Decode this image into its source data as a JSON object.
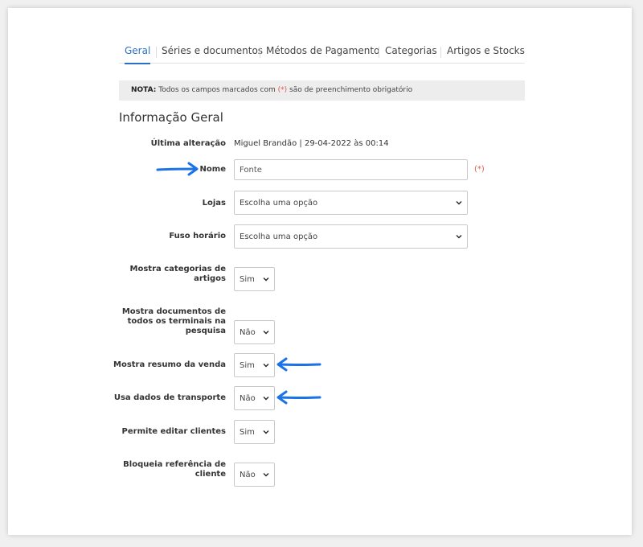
{
  "tabs": [
    {
      "label": "Geral",
      "active": true
    },
    {
      "label": "Séries e documentos",
      "active": false
    },
    {
      "label": "Métodos de Pagamento",
      "active": false
    },
    {
      "label": "Categorias",
      "active": false
    },
    {
      "label": "Artigos e Stocks",
      "active": false
    }
  ],
  "note": {
    "prefix": "NOTA:",
    "text_before": " Todos os campos marcados com ",
    "marker": "(*)",
    "text_after": " são de preenchimento obrigatório"
  },
  "section_title": "Informação Geral",
  "form": {
    "last_change_label": "Última alteração",
    "last_change_value": "Miguel Brandão | 29-04-2022 às 00:14",
    "name_label": "Nome",
    "name_value": "Fonte",
    "required_marker": "(*)",
    "stores_label": "Lojas",
    "stores_value": "Escolha uma opção",
    "timezone_label": "Fuso horário",
    "timezone_value": "Escolha uma opção",
    "show_categories_label": "Mostra categorias de artigos",
    "show_categories_value": "Sim",
    "show_all_docs_label": "Mostra documentos de todos os terminais na pesquisa",
    "show_all_docs_value": "Não",
    "show_summary_label": "Mostra resumo da venda",
    "show_summary_value": "Sim",
    "transport_label": "Usa dados de transporte",
    "transport_value": "Não",
    "edit_clients_label": "Permite editar clientes",
    "edit_clients_value": "Sim",
    "lock_ref_label": "Bloqueia referência de cliente",
    "lock_ref_value": "Não"
  },
  "colors": {
    "accent": "#2b6fc2",
    "required": "#e05b4b",
    "annotation_arrow": "#1a73e8"
  },
  "icons": [
    "chevron-down-icon",
    "arrow-annotation"
  ]
}
